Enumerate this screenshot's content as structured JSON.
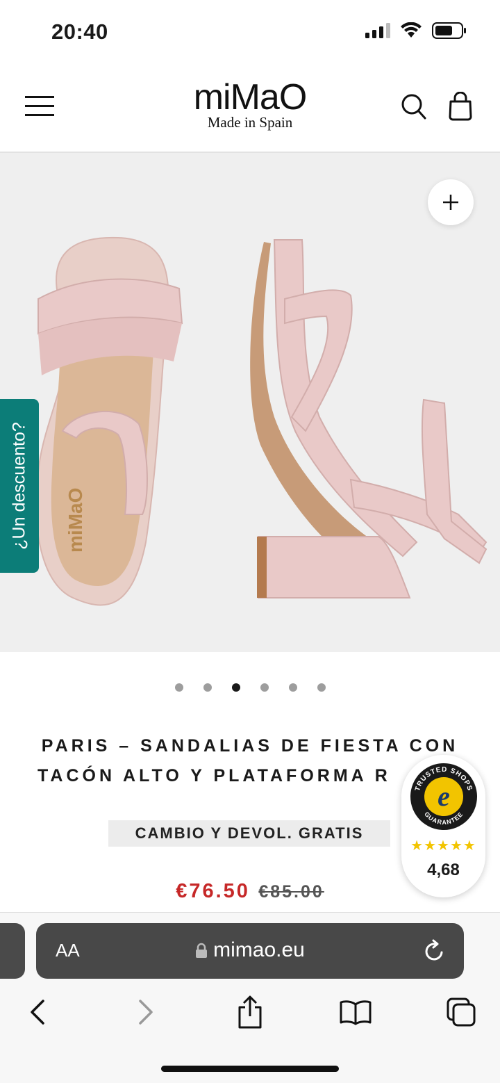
{
  "status_bar": {
    "time": "20:40"
  },
  "header": {
    "logo": "miMaO",
    "tagline": "Made in Spain"
  },
  "gallery": {
    "discount_tab": "¿Un descuento?",
    "dots": 6,
    "active_dot": 3
  },
  "product": {
    "title_line1": "PARIS – SANDALIAS DE FIESTA CON",
    "title_line2": "TACÓN ALTO Y PLATAFORMA R",
    "badge": "CAMBIO Y DEVOL. GRATIS",
    "price_now": "€76.50",
    "price_old": "€85.00"
  },
  "trusted_shops": {
    "label_top": "TRUSTED SHOPS",
    "label_bottom": "GUARANTEE",
    "stars": "★★★★★",
    "rating": "4,68"
  },
  "browser": {
    "text_size": "AA",
    "url": "mimao.eu"
  },
  "colors": {
    "accent_teal": "#0c7d78",
    "price_red": "#c62828",
    "sandal_pink": "#e9c9c8"
  }
}
